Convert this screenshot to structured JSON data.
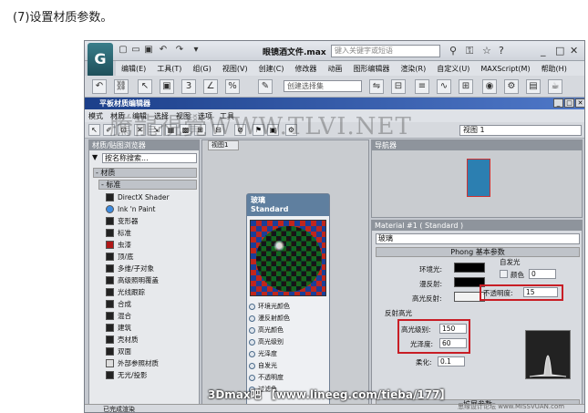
{
  "caption": "(7)设置材质参数。",
  "app": {
    "file_title": "眼镜酒文件.max",
    "search_placeholder": "键入关键字或短语",
    "menu": [
      "编辑(E)",
      "工具(T)",
      "组(G)",
      "视图(V)",
      "创建(C)",
      "修改器",
      "动画",
      "图形编辑器",
      "渲染(R)",
      "自定义(U)",
      "MAXScript(M)",
      "帮助(H)"
    ],
    "selection_set": "创建选择集"
  },
  "editor": {
    "title": "平板材质编辑器",
    "menu": [
      "模式",
      "材质",
      "编辑",
      "选择",
      "视图",
      "选项",
      "工具"
    ],
    "view_select": "视图 1",
    "browser": {
      "header": "材质/贴图浏览器",
      "search": "按名称搜索...",
      "group": "- 材质",
      "subgroup": "- 标准",
      "materials": [
        "DirectX Shader",
        "Ink 'n Paint",
        "变形器",
        "标准",
        "虫漆",
        "顶/底",
        "多维/子对象",
        "高级照明覆盖",
        "光线跟踪",
        "合成",
        "混合",
        "建筑",
        "壳材质",
        "双面",
        "外部参照材质",
        "无光/投影"
      ]
    },
    "view": {
      "tab": "视图1",
      "node_name": "玻璃",
      "node_type": "Standard",
      "slots": [
        "环境光颜色",
        "漫反射颜色",
        "高光颜色",
        "高光级别",
        "光泽度",
        "自发光",
        "不透明度",
        "过滤色"
      ]
    },
    "navigator": {
      "header": "导航器"
    },
    "watermark": "騰龍視覺WWW.TLVI.NET",
    "props": {
      "header": "Material #1 ( Standard )",
      "name": "玻璃",
      "rollout": "Phong 基本参数",
      "ambient": "环境光:",
      "diffuse": "漫反射:",
      "specular": "高光反射:",
      "self_illum": "自发光",
      "color_label": "颜色",
      "self_illum_value": "0",
      "opacity_label": "不透明度:",
      "opacity_value": "15",
      "highlight_group": "反射高光",
      "spec_level_label": "高光级别:",
      "spec_level_value": "150",
      "gloss_label": "光泽度:",
      "gloss_value": "60",
      "soften_label": "柔化:",
      "soften_value": "0.1",
      "ext_rollout": "扩展参数"
    },
    "status": "已完成渲染"
  },
  "footer": "3Dmax吧 【www.lineeg.com/tieba/177】",
  "footer_small": "思缘设计论坛 www.MISSVUAN.com"
}
